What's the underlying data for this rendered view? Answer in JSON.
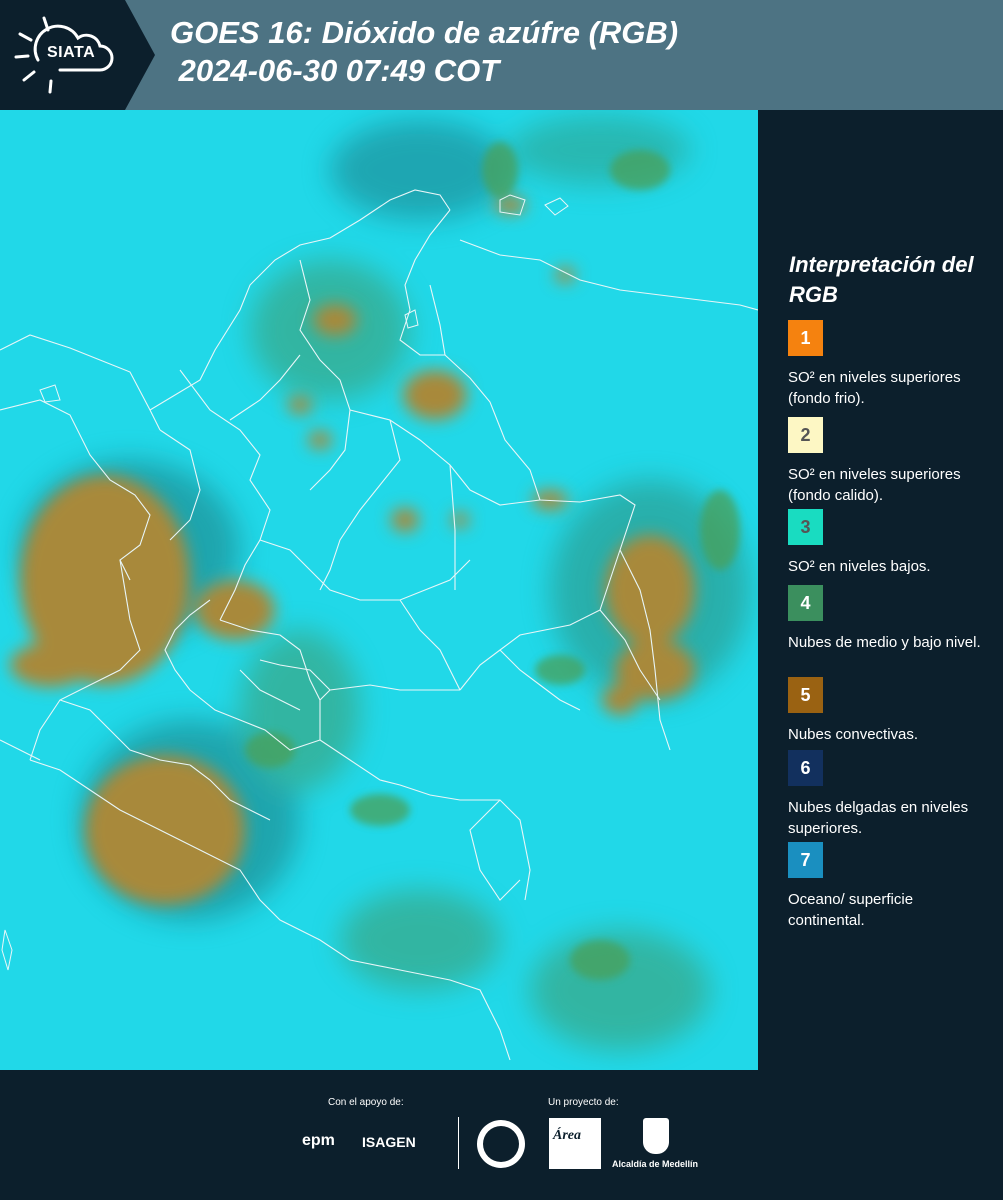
{
  "header": {
    "logo_text": "SIATA",
    "title": "GOES 16: Dióxido de azúfre (RGB)\n 2024-06-30 07:49 COT"
  },
  "map": {
    "product": "GOES 16 SO2 RGB",
    "background_color": "#21d8e8",
    "cloud_color": "#a88a3a",
    "low_cloud_color": "#3f9a5a",
    "border_color": "#e8f6f8"
  },
  "legend": {
    "title": "Interpretación del RGB",
    "items": [
      {
        "number": "1",
        "color": "#f5820f",
        "text": "SO² en niveles superiores (fondo frio)."
      },
      {
        "number": "2",
        "color": "#fdf7c4",
        "text": "SO² en niveles superiores (fondo calido)."
      },
      {
        "number": "3",
        "color": "#19dcc1",
        "text": "SO² en niveles bajos."
      },
      {
        "number": "4",
        "color": "#3b8f5e",
        "text": "Nubes de medio y bajo nivel."
      },
      {
        "number": "5",
        "color": "#9a6212",
        "text": "Nubes convectivas."
      },
      {
        "number": "6",
        "color": "#12305e",
        "text": "Nubes delgadas en niveles superiores."
      },
      {
        "number": "7",
        "color": "#1a8fc0",
        "text": "Oceano/ superficie continental."
      }
    ]
  },
  "footer": {
    "support_label": "Con el apoyo de:",
    "project_label": "Un proyecto de:",
    "epm": "epm",
    "isagen": "ISAGEN",
    "area": "Área",
    "alcaldia": "Alcaldía de Medellín"
  }
}
